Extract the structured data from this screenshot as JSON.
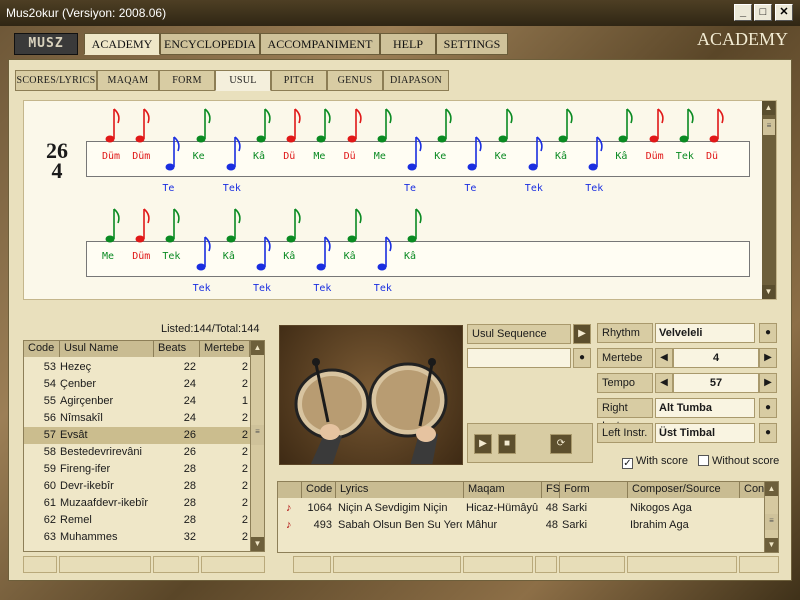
{
  "window": {
    "title": "Mus2okur  (Versiyon: 2008.06)",
    "min": "_",
    "max": "□",
    "close": "✕"
  },
  "nav": {
    "logo": "MUSZ",
    "tabs": [
      "ACADEMY",
      "ENCYCLOPEDIA",
      "ACCOMPANIMENT",
      "HELP",
      "SETTINGS"
    ],
    "active": "ACADEMY",
    "section_title": "ACADEMY"
  },
  "subtabs": {
    "items": [
      "SCORES/LYRICS",
      "MAQAM",
      "FORM",
      "USUL",
      "PITCH",
      "GENUS",
      "DIAPASON"
    ],
    "active": "USUL"
  },
  "score": {
    "time_top": "26",
    "time_bottom": "4",
    "line1": [
      {
        "s": "Düm",
        "c": "red",
        "p": "up"
      },
      {
        "s": "Düm",
        "c": "red",
        "p": "up"
      },
      {
        "s": "Te",
        "c": "blue",
        "p": "down"
      },
      {
        "s": "Ke",
        "c": "green",
        "p": "up"
      },
      {
        "s": "Tek",
        "c": "blue",
        "p": "down"
      },
      {
        "s": "Kâ",
        "c": "green",
        "p": "up"
      },
      {
        "s": "Dü",
        "c": "red",
        "p": "up"
      },
      {
        "s": "Me",
        "c": "green",
        "p": "up"
      },
      {
        "s": "Dü",
        "c": "red",
        "p": "up"
      },
      {
        "s": "Me",
        "c": "green",
        "p": "up"
      },
      {
        "s": "Te",
        "c": "blue",
        "p": "down"
      },
      {
        "s": "Ke",
        "c": "green",
        "p": "up"
      },
      {
        "s": "Te",
        "c": "blue",
        "p": "down"
      },
      {
        "s": "Ke",
        "c": "green",
        "p": "up"
      },
      {
        "s": "Tek",
        "c": "blue",
        "p": "down"
      },
      {
        "s": "Kâ",
        "c": "green",
        "p": "up"
      },
      {
        "s": "Tek",
        "c": "blue",
        "p": "down"
      },
      {
        "s": "Kâ",
        "c": "green",
        "p": "up"
      },
      {
        "s": "Düm",
        "c": "red",
        "p": "up"
      },
      {
        "s": "Tek",
        "c": "green",
        "p": "up"
      },
      {
        "s": "Dü",
        "c": "red",
        "p": "up"
      }
    ],
    "line2": [
      {
        "s": "Me",
        "c": "green",
        "p": "up"
      },
      {
        "s": "Düm",
        "c": "red",
        "p": "up"
      },
      {
        "s": "Tek",
        "c": "green",
        "p": "up"
      },
      {
        "s": "Tek",
        "c": "blue",
        "p": "down"
      },
      {
        "s": "Kâ",
        "c": "green",
        "p": "up"
      },
      {
        "s": "Tek",
        "c": "blue",
        "p": "down"
      },
      {
        "s": "Kâ",
        "c": "green",
        "p": "up"
      },
      {
        "s": "Tek",
        "c": "blue",
        "p": "down"
      },
      {
        "s": "Kâ",
        "c": "green",
        "p": "up"
      },
      {
        "s": "Tek",
        "c": "blue",
        "p": "down"
      },
      {
        "s": "Kâ",
        "c": "green",
        "p": "up"
      }
    ]
  },
  "usul_list": {
    "count_label": "Listed:144/Total:144",
    "headers": [
      "Code",
      "Usul Name",
      "Beats",
      "Mertebe"
    ],
    "rows": [
      [
        "53",
        "Hezeç",
        "22",
        "2"
      ],
      [
        "54",
        "Çenber",
        "24",
        "2"
      ],
      [
        "55",
        "Agirçenber",
        "24",
        "1"
      ],
      [
        "56",
        "Nîmsakîl",
        "24",
        "2"
      ],
      [
        "57",
        "Evsât",
        "26",
        "2"
      ],
      [
        "58",
        "Bestedevrirevâni",
        "26",
        "2"
      ],
      [
        "59",
        "Fireng-ifer",
        "28",
        "2"
      ],
      [
        "60",
        "Devr-ikebîr",
        "28",
        "2"
      ],
      [
        "61",
        "Muzaafdevr-ikebîr",
        "28",
        "2"
      ],
      [
        "62",
        "Remel",
        "28",
        "2"
      ],
      [
        "63",
        "Muhammes",
        "32",
        "2"
      ]
    ],
    "selected_index": 4
  },
  "controls": {
    "usul_sequence": "Usul Sequence",
    "rhythm_label": "Rhythm",
    "rhythm_value": "Velveleli",
    "mertebe_label": "Mertebe",
    "mertebe_value": "4",
    "tempo_label": "Tempo",
    "tempo_value": "57",
    "right_label": "Right Instr.",
    "right_value": "Alt Tumba",
    "left_label": "Left Instr.",
    "left_value": "Üst Timbal",
    "with_score": "With score",
    "without_score": "Without score",
    "with_score_checked": true
  },
  "songs": {
    "headers": [
      "Code",
      "Lyrics",
      "Maqam",
      "FS",
      "Form",
      "Composer/Source",
      "Con"
    ],
    "rows": [
      [
        "1064",
        "Niçin A Sevdigim Niçin",
        "Hicaz-Hümâyû",
        "48",
        "Sarki",
        "Nikogos Aga"
      ],
      [
        "493",
        "Sabah Olsun Ben Su Yerde",
        "Mâhur",
        "48",
        "Sarki",
        "Ibrahim Aga"
      ]
    ]
  },
  "colors": {
    "red": "#e01818",
    "blue": "#1a2ee0",
    "green": "#0a8a22"
  }
}
